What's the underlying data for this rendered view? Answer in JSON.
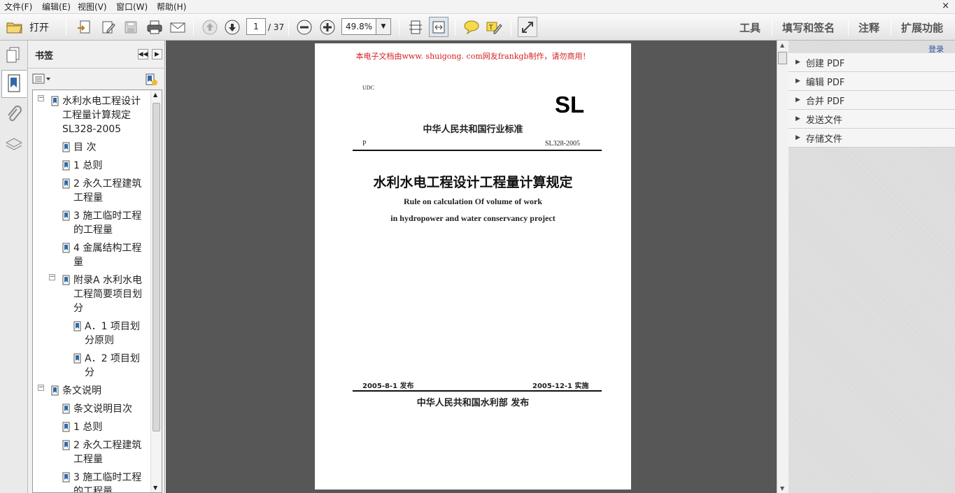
{
  "menubar": {
    "items": [
      "文件(F)",
      "编辑(E)",
      "视图(V)",
      "窗口(W)",
      "帮助(H)"
    ],
    "close_glyph": "×"
  },
  "toolbar": {
    "open_label": "打开",
    "page_number": "1",
    "page_total": "/ 37",
    "zoom": "49.8%",
    "right_links": [
      "工具",
      "填写和签名",
      "注释",
      "扩展功能"
    ]
  },
  "nav_panel": {
    "title": "书签",
    "bookmarks": [
      {
        "label": "水利水电工程设计工程量计算规定SL328-2005",
        "level": 0
      },
      {
        "label": "目 次",
        "level": 1
      },
      {
        "label": "1 总则",
        "level": 1
      },
      {
        "label": "2 永久工程建筑工程量",
        "level": 1
      },
      {
        "label": "3 施工临时工程的工程量",
        "level": 1
      },
      {
        "label": "4 金属结构工程量",
        "level": 1
      },
      {
        "label": "附录A 水利水电工程简要项目划分",
        "level": 1
      },
      {
        "label": "A．1 项目划分原则",
        "level": 2
      },
      {
        "label": "A．2 项目划分",
        "level": 2
      },
      {
        "label": "条文说明",
        "level": 0
      },
      {
        "label": "条文说明目次",
        "level": 1
      },
      {
        "label": "1 总则",
        "level": 1
      },
      {
        "label": "2 永久工程建筑工程量",
        "level": 1
      },
      {
        "label": "3 施工临时工程的工程量",
        "level": 1
      }
    ]
  },
  "document": {
    "watermark": "本电子文档由www. shuigong. com网友frankgb制作，请勿商用！",
    "udc": "UDC",
    "sl_mark": "SL",
    "category": "中华人民共和国行业标准",
    "p_code": "P",
    "standard_no": "SL328-2005",
    "title_cn": "水利水电工程设计工程量计算规定",
    "title_en_1": "Rule on calculation Of volume of work",
    "title_en_2": "in hydropower and water conservancy project",
    "publish_date": "2005-8-1 发布",
    "effective_date": "2005-12-1 实施",
    "publisher": "中华人民共和国水利部  发布"
  },
  "right_panel": {
    "login": "登录",
    "items": [
      "创建 PDF",
      "编辑 PDF",
      "合并 PDF",
      "发送文件",
      "存储文件"
    ]
  },
  "colors": {
    "viewer_bg": "#575757",
    "watermark_red": "#d42020",
    "link_blue": "#2a50a8"
  }
}
